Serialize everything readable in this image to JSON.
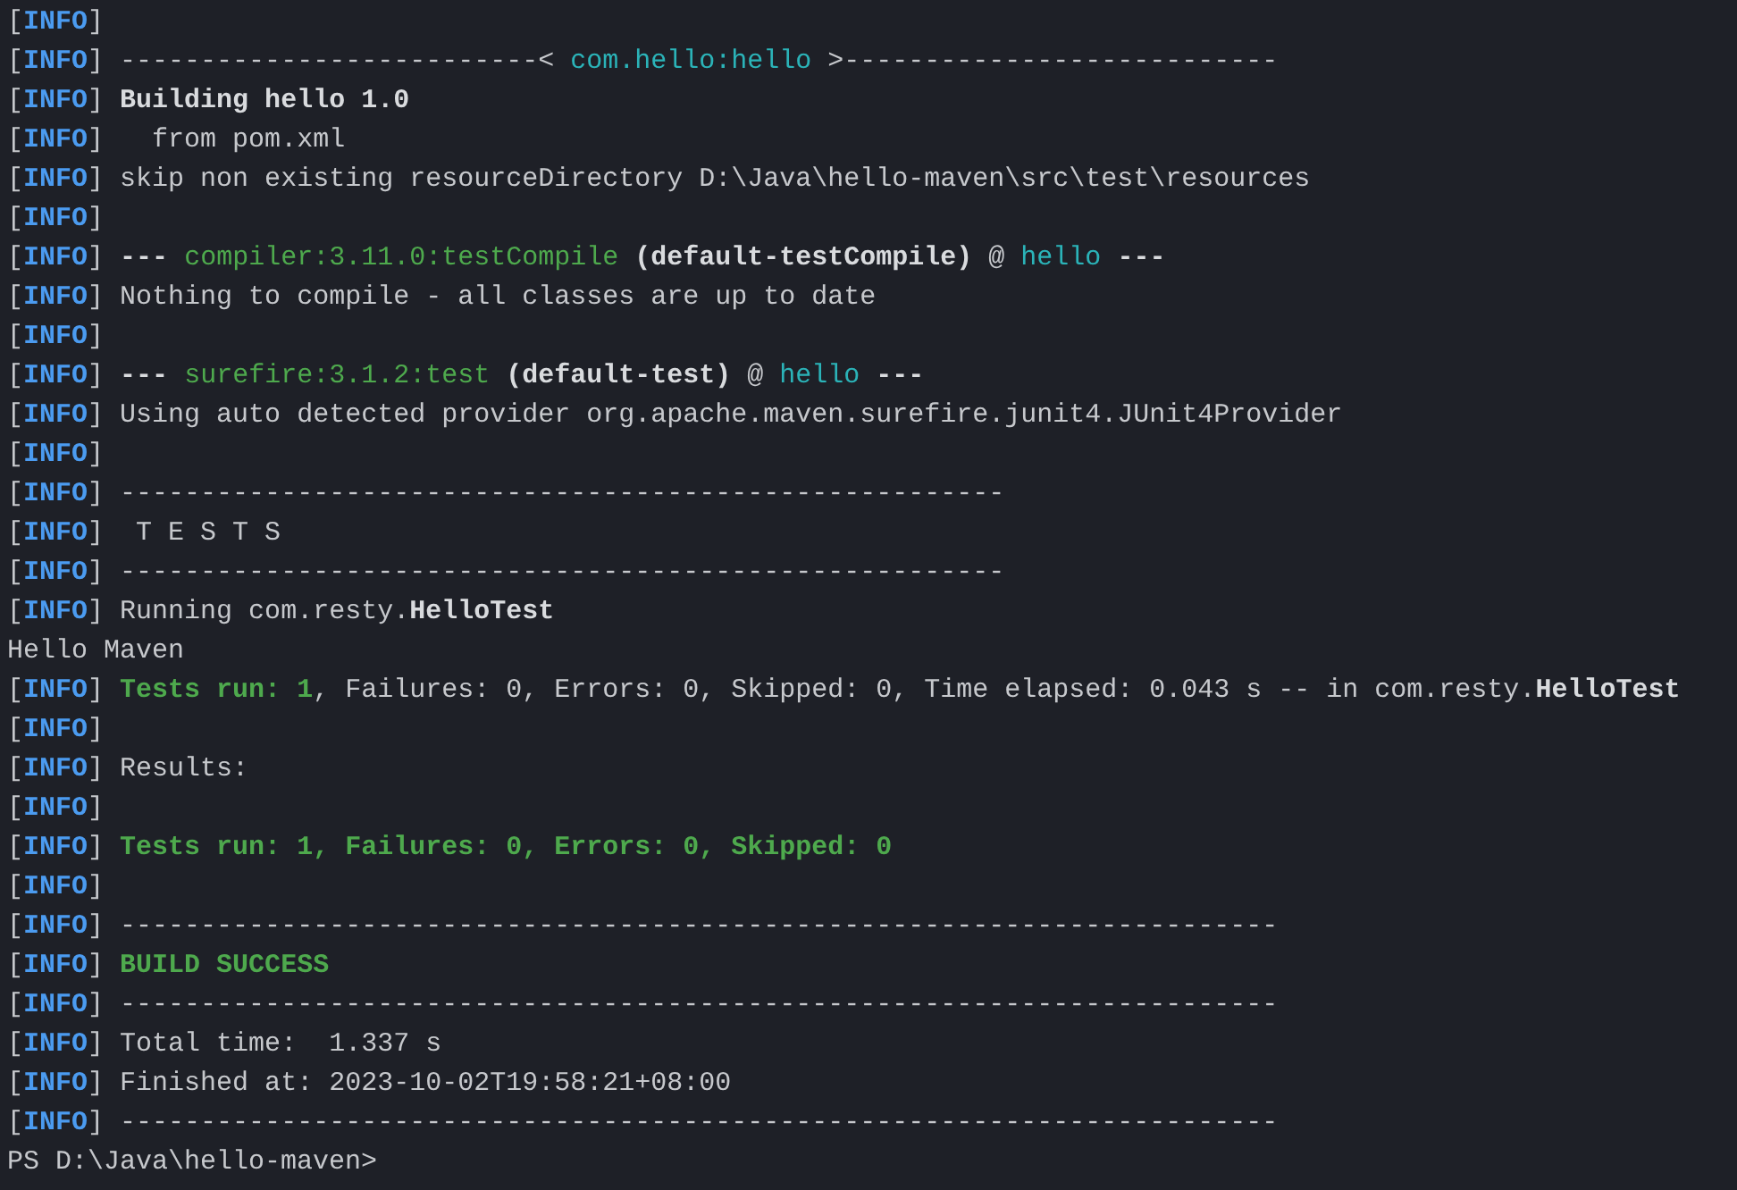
{
  "terminal": {
    "lines": [
      {
        "tag": [
          "[",
          "INFO",
          "]"
        ]
      },
      {
        "tag": [
          "[",
          "INFO",
          "]"
        ],
        "segments": [
          {
            "kind": "plain",
            "text": " --------------------------< "
          },
          {
            "kind": "cyan",
            "text": "com.hello:hello"
          },
          {
            "kind": "plain",
            "text": " >---------------------------"
          }
        ]
      },
      {
        "tag": [
          "[",
          "INFO",
          "]"
        ],
        "segments": [
          {
            "kind": "bold",
            "text": " Building hello 1.0"
          }
        ]
      },
      {
        "tag": [
          "[",
          "INFO",
          "]"
        ],
        "segments": [
          {
            "kind": "plain",
            "text": "   from pom.xml"
          }
        ]
      },
      {
        "tag": [
          "[",
          "INFO",
          "]"
        ],
        "segments": [
          {
            "kind": "plain",
            "text": " skip non existing resourceDirectory D:\\Java\\hello-maven\\src\\test\\resources"
          }
        ]
      },
      {
        "tag": [
          "[",
          "INFO",
          "]"
        ]
      },
      {
        "tag": [
          "[",
          "INFO",
          "]"
        ],
        "segments": [
          {
            "kind": "bold",
            "text": " ---"
          },
          {
            "kind": "green",
            "text": " compiler:3.11.0:testCompile"
          },
          {
            "kind": "bold",
            "text": " (default-testCompile)"
          },
          {
            "kind": "plain",
            "text": " @ "
          },
          {
            "kind": "cyan",
            "text": "hello"
          },
          {
            "kind": "bold",
            "text": " ---"
          }
        ]
      },
      {
        "tag": [
          "[",
          "INFO",
          "]"
        ],
        "segments": [
          {
            "kind": "plain",
            "text": " Nothing to compile - all classes are up to date"
          }
        ]
      },
      {
        "tag": [
          "[",
          "INFO",
          "]"
        ]
      },
      {
        "tag": [
          "[",
          "INFO",
          "]"
        ],
        "segments": [
          {
            "kind": "bold",
            "text": " ---"
          },
          {
            "kind": "green",
            "text": " surefire:3.1.2:test"
          },
          {
            "kind": "bold",
            "text": " (default-test)"
          },
          {
            "kind": "plain",
            "text": " @ "
          },
          {
            "kind": "cyan",
            "text": "hello"
          },
          {
            "kind": "bold",
            "text": " ---"
          }
        ]
      },
      {
        "tag": [
          "[",
          "INFO",
          "]"
        ],
        "segments": [
          {
            "kind": "plain",
            "text": " Using auto detected provider org.apache.maven.surefire.junit4.JUnit4Provider"
          }
        ]
      },
      {
        "tag": [
          "[",
          "INFO",
          "]"
        ]
      },
      {
        "tag": [
          "[",
          "INFO",
          "]"
        ],
        "segments": [
          {
            "kind": "plain",
            "text": " -------------------------------------------------------"
          }
        ]
      },
      {
        "tag": [
          "[",
          "INFO",
          "]"
        ],
        "segments": [
          {
            "kind": "plain",
            "text": "  T E S T S"
          }
        ]
      },
      {
        "tag": [
          "[",
          "INFO",
          "]"
        ],
        "segments": [
          {
            "kind": "plain",
            "text": " -------------------------------------------------------"
          }
        ]
      },
      {
        "tag": [
          "[",
          "INFO",
          "]"
        ],
        "segments": [
          {
            "kind": "plain",
            "text": " Running com.resty."
          },
          {
            "kind": "bold",
            "text": "HelloTest"
          }
        ]
      },
      {
        "segments": [
          {
            "kind": "plain",
            "text": "Hello Maven"
          }
        ]
      },
      {
        "tag": [
          "[",
          "INFO",
          "]"
        ],
        "segments": [
          {
            "kind": "greenbold",
            "text": " Tests run: 1"
          },
          {
            "kind": "plain",
            "text": ", Failures: 0, Errors: 0, Skipped: 0, Time elapsed: 0.043 s -- in com.resty."
          },
          {
            "kind": "bold",
            "text": "HelloTest"
          }
        ]
      },
      {
        "tag": [
          "[",
          "INFO",
          "]"
        ]
      },
      {
        "tag": [
          "[",
          "INFO",
          "]"
        ],
        "segments": [
          {
            "kind": "plain",
            "text": " Results:"
          }
        ]
      },
      {
        "tag": [
          "[",
          "INFO",
          "]"
        ]
      },
      {
        "tag": [
          "[",
          "INFO",
          "]"
        ],
        "segments": [
          {
            "kind": "greenbold",
            "text": " Tests run: 1, Failures: 0, Errors: 0, Skipped: 0"
          }
        ]
      },
      {
        "tag": [
          "[",
          "INFO",
          "]"
        ]
      },
      {
        "tag": [
          "[",
          "INFO",
          "]"
        ],
        "segments": [
          {
            "kind": "plain",
            "text": " ------------------------------------------------------------------------"
          }
        ]
      },
      {
        "tag": [
          "[",
          "INFO",
          "]"
        ],
        "segments": [
          {
            "kind": "greenbold",
            "text": " BUILD SUCCESS"
          }
        ]
      },
      {
        "tag": [
          "[",
          "INFO",
          "]"
        ],
        "segments": [
          {
            "kind": "plain",
            "text": " ------------------------------------------------------------------------"
          }
        ]
      },
      {
        "tag": [
          "[",
          "INFO",
          "]"
        ],
        "segments": [
          {
            "kind": "plain",
            "text": " Total time:  1.337 s"
          }
        ]
      },
      {
        "tag": [
          "[",
          "INFO",
          "]"
        ],
        "segments": [
          {
            "kind": "plain",
            "text": " Finished at: 2023-10-02T19:58:21+08:00"
          }
        ]
      },
      {
        "tag": [
          "[",
          "INFO",
          "]"
        ],
        "segments": [
          {
            "kind": "plain",
            "text": " ------------------------------------------------------------------------"
          }
        ]
      },
      {
        "segments": [
          {
            "kind": "plain",
            "text": "PS D:\\Java\\hello-maven>"
          }
        ]
      }
    ]
  }
}
